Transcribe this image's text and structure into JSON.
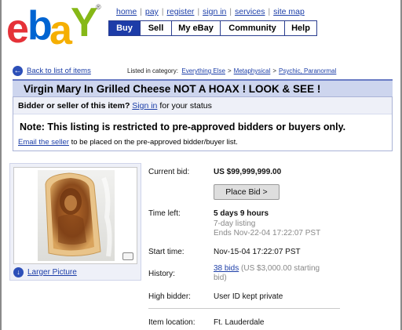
{
  "logo": {
    "letters": [
      "e",
      "b",
      "a",
      "Y"
    ],
    "colors": [
      "#e53238",
      "#0064d2",
      "#f5af02",
      "#86b817"
    ],
    "trademark": "®"
  },
  "top_links": [
    "home",
    "pay",
    "register",
    "sign in",
    "services",
    "site map"
  ],
  "nav_tabs": [
    "Buy",
    "Sell",
    "My eBay",
    "Community",
    "Help"
  ],
  "breadcrumb": {
    "back_label": "Back to list of items",
    "listed_label": "Listed in category:",
    "categories": [
      "Everything Else",
      "Metaphysical",
      "Psychic, Paranormal"
    ]
  },
  "listing": {
    "title": "Virgin Mary In Grilled Cheese NOT A HOAX ! LOOK & SEE !",
    "status_prefix": "Bidder or seller of this item?",
    "sign_in_label": "Sign in",
    "status_suffix": "for your status",
    "note": "Note: This listing is restricted to pre-approved bidders or buyers only.",
    "email_link": "Email the seller",
    "email_suffix": "to be placed on the pre-approved bidder/buyer list."
  },
  "image_panel": {
    "larger_label": "Larger Picture"
  },
  "details": {
    "current_bid_label": "Current bid:",
    "current_bid_value": "US $99,999,999.00",
    "place_bid_label": "Place Bid >",
    "time_left_label": "Time left:",
    "time_left_value": "5 days 9 hours",
    "listing_length": "7-day listing",
    "ends": "Ends Nov-22-04 17:22:07 PST",
    "start_time_label": "Start time:",
    "start_time_value": "Nov-15-04 17:22:07 PST",
    "history_label": "History:",
    "bids_link": "38 bids",
    "starting_bid": "(US $3,000.00 starting",
    "starting_bid_2": "bid)",
    "high_bidder_label": "High bidder:",
    "high_bidder_value": "User ID kept private",
    "item_location_label": "Item location:",
    "item_location_value": "Ft. Lauderdale"
  }
}
